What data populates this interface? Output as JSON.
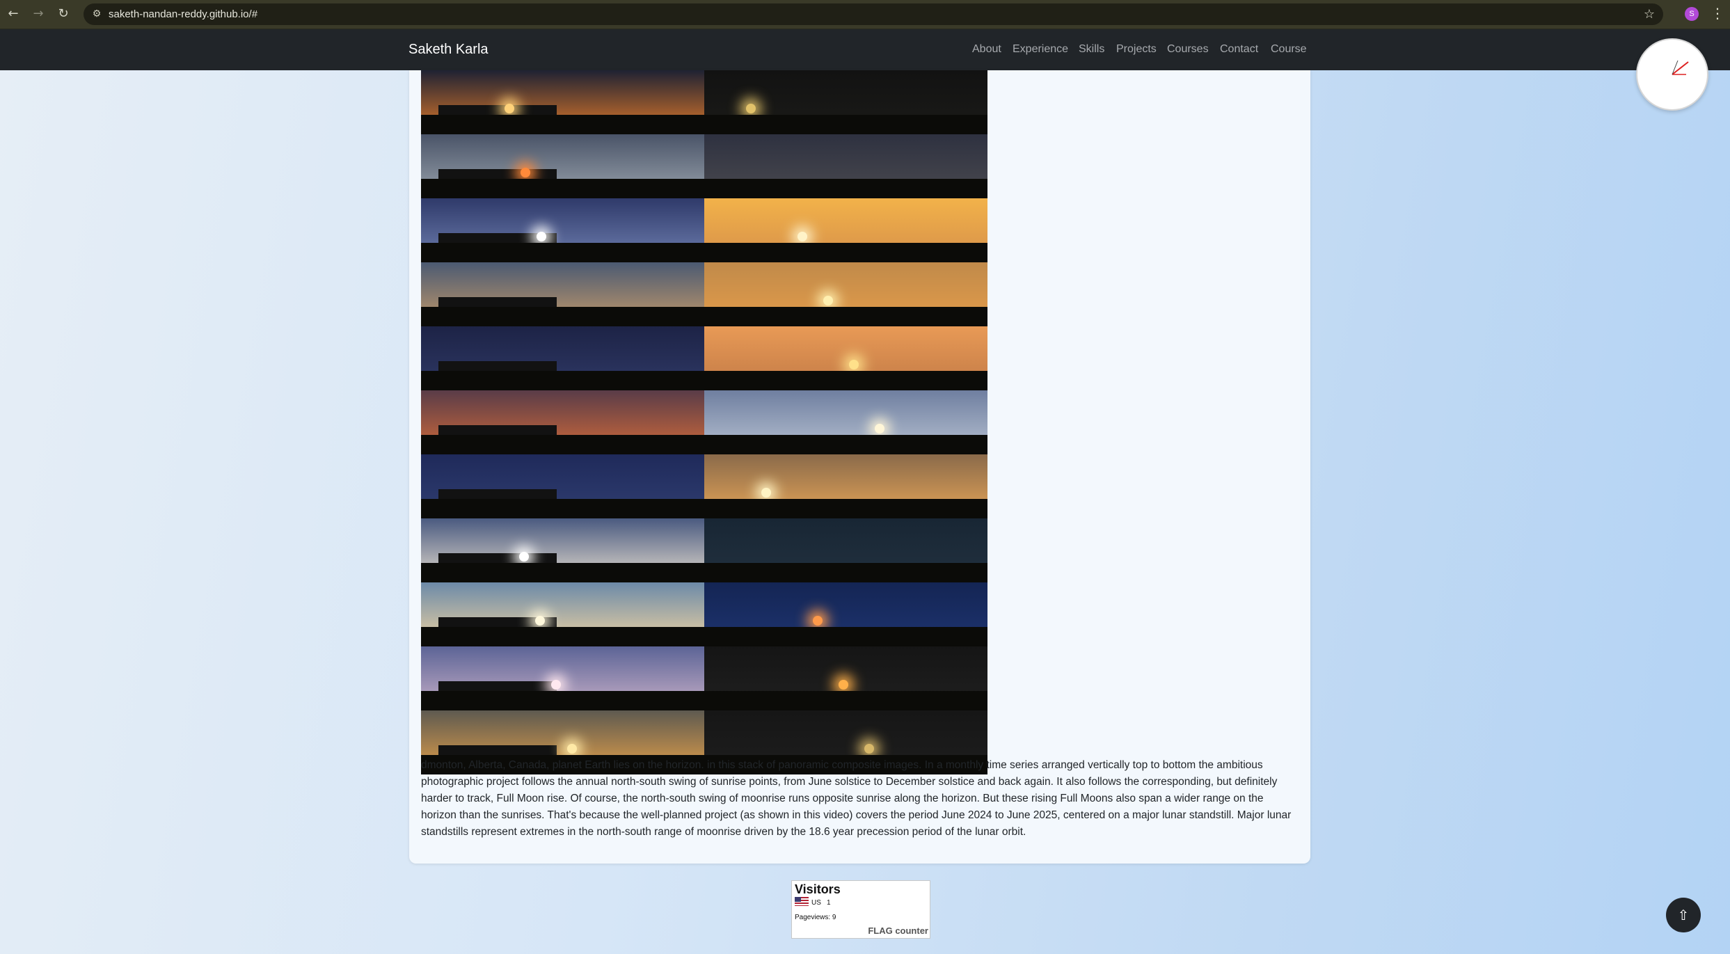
{
  "browser": {
    "url": "saketh-nandan-reddy.github.io/#",
    "back_icon": "←",
    "forward_icon": "→",
    "reload_icon": "↻",
    "site_info_icon": "⚙",
    "bookmark_icon": "☆",
    "profile_initial": "S",
    "menu_icon": "⋮"
  },
  "navbar": {
    "brand": "Saketh Karla",
    "links": [
      "About",
      "Experience",
      "Skills",
      "Projects",
      "Courses",
      "Contact",
      "Course"
    ]
  },
  "gallery": {
    "description": "dmonton, Alberta, Canada, planet Earth lies on the horizon. in this stack of panoramic composite images. In a monthly time series arranged vertically top to bottom the ambitious photographic project follows the annual north-south swing of sunrise points, from June solstice to December solstice and back again. It also follows the corresponding, but definitely harder to track, Full Moon rise. Of course, the north-south swing of moonrise runs opposite sunrise along the horizon. But these rising Full Moons also span a wider range on the horizon than the sunrises. That's because the well-planned project (as shown in this video) covers the period June 2024 to June 2025, centered on a major lunar standstill. Major lunar standstills represent extremes in the north-south range of moonrise driven by the 18.6 year precession period of the lunar orbit.",
    "rows": [
      {
        "left": {
          "sky": [
            "#1f2233",
            "#e07a2a"
          ],
          "sun": "#ffd27a"
        },
        "right": {
          "sky": [
            "#121212",
            "#1b1b18"
          ],
          "sun": "#e2c26a"
        }
      },
      {
        "left": {
          "sky": [
            "#4a5468",
            "#9aa3ad"
          ],
          "sun": "#ff8a3a"
        },
        "right": {
          "sky": [
            "#2e3140",
            "#4a4a4f"
          ],
          "sun": ""
        }
      },
      {
        "left": {
          "sky": [
            "#2f3a6a",
            "#6f7fb0"
          ],
          "sun": "#ffffff"
        },
        "right": {
          "sky": [
            "#f2b24a",
            "#d6904a"
          ],
          "sun": "#fff3c8"
        }
      },
      {
        "left": {
          "sky": [
            "#4b5a72",
            "#c49a6a"
          ],
          "sun": ""
        },
        "right": {
          "sky": [
            "#c08a4a",
            "#e59d4a"
          ],
          "sun": "#fff0b0"
        }
      },
      {
        "left": {
          "sky": [
            "#1d2346",
            "#2f3966"
          ],
          "sun": ""
        },
        "right": {
          "sky": [
            "#e89a56",
            "#c27a46"
          ],
          "sun": "#ffe08a"
        }
      },
      {
        "left": {
          "sky": [
            "#5a3c48",
            "#d26b3a"
          ],
          "sun": ""
        },
        "right": {
          "sky": [
            "#6f7fa0",
            "#b8c2d2"
          ],
          "sun": "#fff6d8"
        }
      },
      {
        "left": {
          "sky": [
            "#1f2a5a",
            "#303e72"
          ],
          "sun": ""
        },
        "right": {
          "sky": [
            "#8a6a4a",
            "#e6a658"
          ],
          "sun": "#fff4c4"
        }
      },
      {
        "left": {
          "sky": [
            "#4a5a80",
            "#e4dccf"
          ],
          "sun": "#ffffff"
        },
        "right": {
          "sky": [
            "#182634",
            "#22313f"
          ],
          "sun": ""
        }
      },
      {
        "left": {
          "sky": [
            "#6c8aa8",
            "#f0d4a2"
          ],
          "sun": "#fff8dc"
        },
        "right": {
          "sky": [
            "#142554",
            "#1e3470"
          ],
          "sun": "#ff9a4a"
        }
      },
      {
        "left": {
          "sky": [
            "#5c6496",
            "#c8b0c8"
          ],
          "sun": "#ffe8ef"
        },
        "right": {
          "sky": [
            "#151515",
            "#202020"
          ],
          "sun": "#ffb04a"
        }
      },
      {
        "left": {
          "sky": [
            "#5e5a50",
            "#e3a04a"
          ],
          "sun": "#ffe9a6"
        },
        "right": {
          "sky": [
            "#161616",
            "#1e1e1e"
          ],
          "sun": "#d8b86a"
        }
      }
    ]
  },
  "visitors": {
    "title": "Visitors",
    "country": "US",
    "count": "1",
    "pageviews": "Pageviews:  9",
    "brand": "FLAG counter"
  },
  "back_to_top_icon": "⇧"
}
